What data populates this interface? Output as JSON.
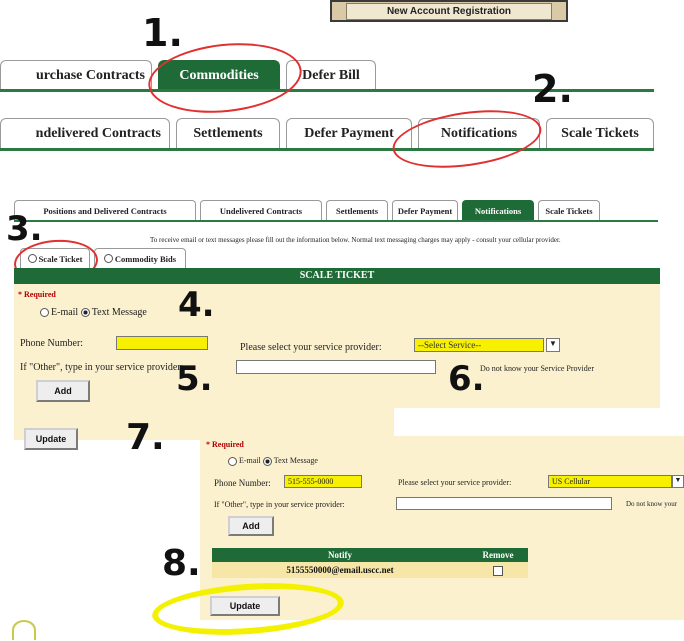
{
  "steps": [
    "1.",
    "2.",
    "3.",
    "4.",
    "5.",
    "6.",
    "7.",
    "8."
  ],
  "top_button": "New Account Registration",
  "tabs_main": [
    "urchase Contracts",
    "Commodities",
    "Defer Bill"
  ],
  "tabs_sub": [
    "ndelivered Contracts",
    "Settlements",
    "Defer Payment",
    "Notifications",
    "Scale Tickets"
  ],
  "tabs_small": [
    "Positions and Delivered Contracts",
    "Undelivered Contracts",
    "Settlements",
    "Defer Payment",
    "Notifications",
    "Scale Tickets"
  ],
  "instructions": "To receive email or text messages please fill out the information below. Normal text messaging charges may apply - consult your cellular provider.",
  "subtabs": [
    "Scale Ticket",
    "Commodity Bids"
  ],
  "section_header": "SCALE TICKET",
  "required_label": "* Required",
  "radio_email": "E-mail",
  "radio_text": "Text Message",
  "phone_label": "Phone Number:",
  "provider_label": "Please select your service provider:",
  "provider_select": "--Select Service--",
  "other_label": "If \"Other\", type in your service provider:",
  "not_know_label": "Do not know your Service Provider",
  "add_label": "Add",
  "update_label": "Update",
  "form2": {
    "required_label": "* Required",
    "radio_email": "E-mail",
    "radio_text": "Text Message",
    "phone_label": "Phone Number:",
    "phone_value": "515-555-0000",
    "provider_label": "Please select your service provider:",
    "provider_value": "US Cellular",
    "other_label": "If \"Other\", type in your service provider:",
    "not_know_label": "Do not know your",
    "add_label": "Add",
    "table_headers": [
      "Notify",
      "Remove"
    ],
    "table_row": "5155550000@email.uscc.net",
    "update_label": "Update"
  },
  "colors": {
    "tab_green": "#1f6b38",
    "panel_cream": "#fbf1cf",
    "highlight_yellow": "#f7f000",
    "annotation_red": "#e03030"
  }
}
